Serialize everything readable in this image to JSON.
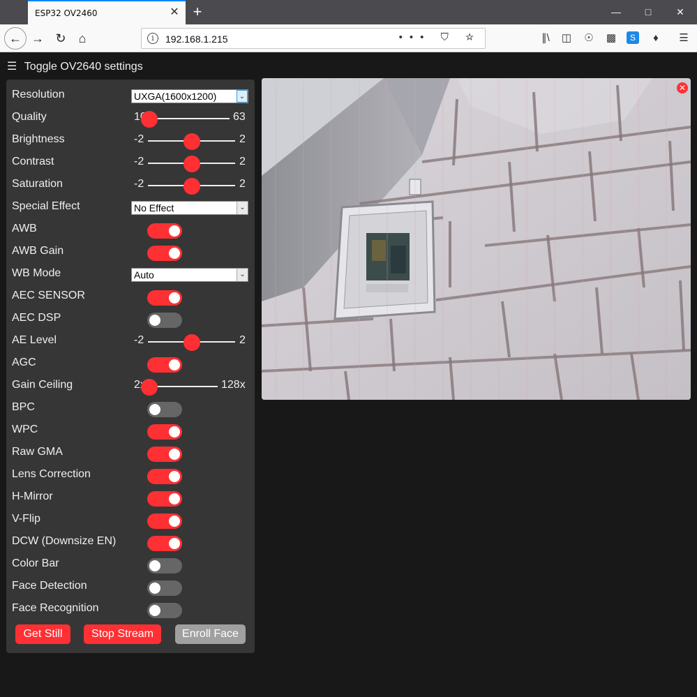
{
  "browser": {
    "tab_title": "ESP32 OV2460",
    "tab_close": "✕",
    "new_tab": "+",
    "url": "192.168.1.215",
    "url_actions": "••• ⛉ ☆"
  },
  "page": {
    "toggle_label": "Toggle OV2640 settings",
    "menu_icon": "☰"
  },
  "settings": {
    "resolution": {
      "label": "Resolution",
      "value": "UXGA(1600x1200)"
    },
    "quality": {
      "label": "Quality",
      "min": "10",
      "max": "63",
      "value": 10,
      "range": [
        10,
        63
      ]
    },
    "brightness": {
      "label": "Brightness",
      "min": "-2",
      "max": "2",
      "value": 0,
      "range": [
        -2,
        2
      ]
    },
    "contrast": {
      "label": "Contrast",
      "min": "-2",
      "max": "2",
      "value": 0,
      "range": [
        -2,
        2
      ]
    },
    "saturation": {
      "label": "Saturation",
      "min": "-2",
      "max": "2",
      "value": 0,
      "range": [
        -2,
        2
      ]
    },
    "special_effect": {
      "label": "Special Effect",
      "value": "No Effect"
    },
    "awb": {
      "label": "AWB",
      "on": true
    },
    "awb_gain": {
      "label": "AWB Gain",
      "on": true
    },
    "wb_mode": {
      "label": "WB Mode",
      "value": "Auto"
    },
    "aec_sensor": {
      "label": "AEC SENSOR",
      "on": true
    },
    "aec_dsp": {
      "label": "AEC DSP",
      "on": false
    },
    "ae_level": {
      "label": "AE Level",
      "min": "-2",
      "max": "2",
      "value": 0,
      "range": [
        -2,
        2
      ]
    },
    "agc": {
      "label": "AGC",
      "on": true
    },
    "gain_ceiling": {
      "label": "Gain Ceiling",
      "min": "2x",
      "max": "128x",
      "value": 0,
      "range": [
        0,
        6
      ]
    },
    "bpc": {
      "label": "BPC",
      "on": false
    },
    "wpc": {
      "label": "WPC",
      "on": true
    },
    "raw_gma": {
      "label": "Raw GMA",
      "on": true
    },
    "lens_correction": {
      "label": "Lens Correction",
      "on": true
    },
    "h_mirror": {
      "label": "H-Mirror",
      "on": true
    },
    "v_flip": {
      "label": "V-Flip",
      "on": true
    },
    "dcw": {
      "label": "DCW (Downsize EN)",
      "on": true
    },
    "color_bar": {
      "label": "Color Bar",
      "on": false
    },
    "face_detection": {
      "label": "Face Detection",
      "on": false
    },
    "face_recognition": {
      "label": "Face Recognition",
      "on": false
    }
  },
  "buttons": {
    "get_still": "Get Still",
    "stop_stream": "Stop Stream",
    "enroll_face": "Enroll Face"
  },
  "colors": {
    "accent": "#ff3034",
    "panel": "#363636",
    "background": "#181818",
    "disabled": "#a0a0a0"
  }
}
